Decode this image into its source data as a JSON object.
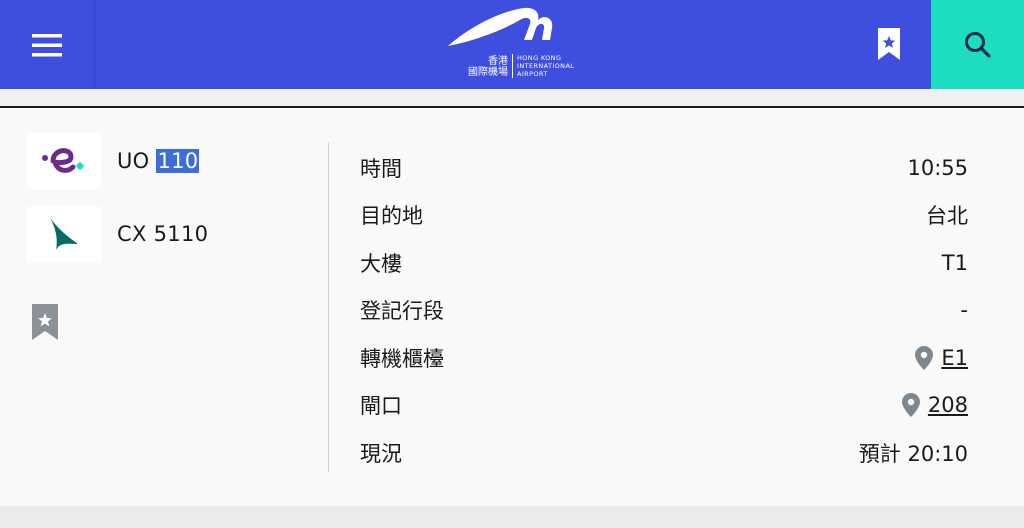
{
  "header": {
    "logo_zh_line1": "香港",
    "logo_zh_line2": "國際機場",
    "logo_en_line1": "HONG KONG",
    "logo_en_line2": "INTERNATIONAL",
    "logo_en_line3": "AIRPORT",
    "menu_icon": "hamburger-menu-icon",
    "bookmark_icon": "bookmark-star-icon",
    "search_icon": "search-icon",
    "colors": {
      "header_bg": "#3e4fe0",
      "search_bg": "#1cdcc2"
    }
  },
  "flights": [
    {
      "airline_logo": "hk-express-logo",
      "prefix": "UO ",
      "number": "110"
    },
    {
      "airline_logo": "cathay-pacific-logo",
      "code": "CX 5110"
    }
  ],
  "details": {
    "time": {
      "label": "時間",
      "value": "10:55"
    },
    "destination": {
      "label": "目的地",
      "value": "台北"
    },
    "terminal": {
      "label": "大樓",
      "value": "T1"
    },
    "checkin": {
      "label": "登記行段",
      "value": "-"
    },
    "transfer": {
      "label": "轉機櫃檯",
      "value": "E1"
    },
    "gate": {
      "label": "閘口",
      "value": "208"
    },
    "status": {
      "label": "現況",
      "value": "預計 20:10"
    }
  }
}
